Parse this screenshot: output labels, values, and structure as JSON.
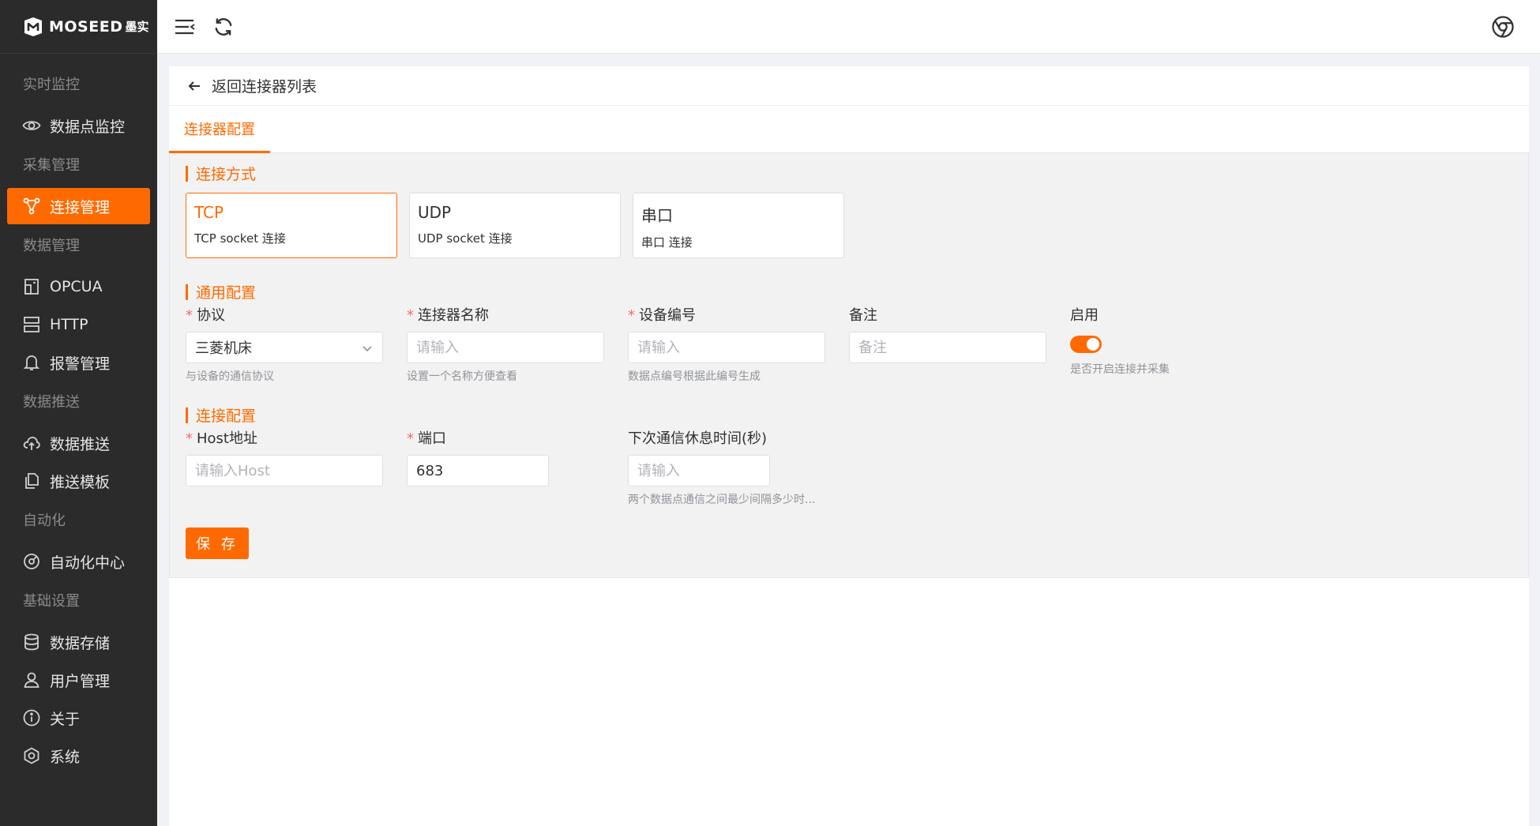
{
  "app": {
    "brand": "MOSEED",
    "brand_sub": "墨实"
  },
  "sidebar": {
    "groups": [
      {
        "label": "实时监控",
        "items": [
          {
            "label": "数据点监控",
            "icon": "eye-icon"
          }
        ]
      },
      {
        "label": "采集管理",
        "items": [
          {
            "label": "连接管理",
            "icon": "connection-icon",
            "active": true
          }
        ]
      },
      {
        "label": "数据管理",
        "items": [
          {
            "label": "OPCUA",
            "icon": "opcua-icon"
          },
          {
            "label": "HTTP",
            "icon": "server-icon"
          },
          {
            "label": "报警管理",
            "icon": "bell-icon"
          }
        ]
      },
      {
        "label": "数据推送",
        "items": [
          {
            "label": "数据推送",
            "icon": "cloud-upload-icon"
          },
          {
            "label": "推送模板",
            "icon": "template-icon"
          }
        ]
      },
      {
        "label": "自动化",
        "items": [
          {
            "label": "自动化中心",
            "icon": "automation-icon"
          }
        ]
      },
      {
        "label": "基础设置",
        "items": [
          {
            "label": "数据存储",
            "icon": "database-icon"
          },
          {
            "label": "用户管理",
            "icon": "user-icon"
          },
          {
            "label": "关于",
            "icon": "info-icon"
          },
          {
            "label": "系统",
            "icon": "settings-icon"
          }
        ]
      }
    ]
  },
  "topbar": {
    "menu_icon": "menu-fold-icon",
    "refresh_icon": "refresh-icon",
    "browser_icon": "chrome-icon"
  },
  "page": {
    "back_label": "返回连接器列表",
    "tab_label": "连接器配置"
  },
  "connection_method": {
    "section_title": "连接方式",
    "options": [
      {
        "title": "TCP",
        "desc": "TCP socket 连接",
        "selected": true
      },
      {
        "title": "UDP",
        "desc": "UDP socket 连接",
        "selected": false
      },
      {
        "title": "串口",
        "desc": "串口 连接",
        "selected": false
      }
    ]
  },
  "general": {
    "section_title": "通用配置",
    "protocol": {
      "label": "协议",
      "value": "三菱机床",
      "help": "与设备的通信协议"
    },
    "name": {
      "label": "连接器名称",
      "placeholder": "请输入",
      "help": "设置一个名称方便查看"
    },
    "device_no": {
      "label": "设备编号",
      "placeholder": "请输入",
      "help": "数据点编号根据此编号生成"
    },
    "remark": {
      "label": "备注",
      "placeholder": "备注"
    },
    "enable": {
      "label": "启用",
      "on": true,
      "help": "是否开启连接并采集"
    }
  },
  "connection": {
    "section_title": "连接配置",
    "host": {
      "label": "Host地址",
      "placeholder": "请输入Host"
    },
    "port": {
      "label": "端口",
      "value": "683"
    },
    "interval": {
      "label": "下次通信休息时间(秒)",
      "placeholder": "请输入",
      "help": "两个数据点通信之间最少间隔多少时..."
    }
  },
  "actions": {
    "save_label": "保 存"
  },
  "colors": {
    "accent": "#ff6a00",
    "sidebar_bg": "#2b2b2b",
    "required": "#f56c6c"
  }
}
